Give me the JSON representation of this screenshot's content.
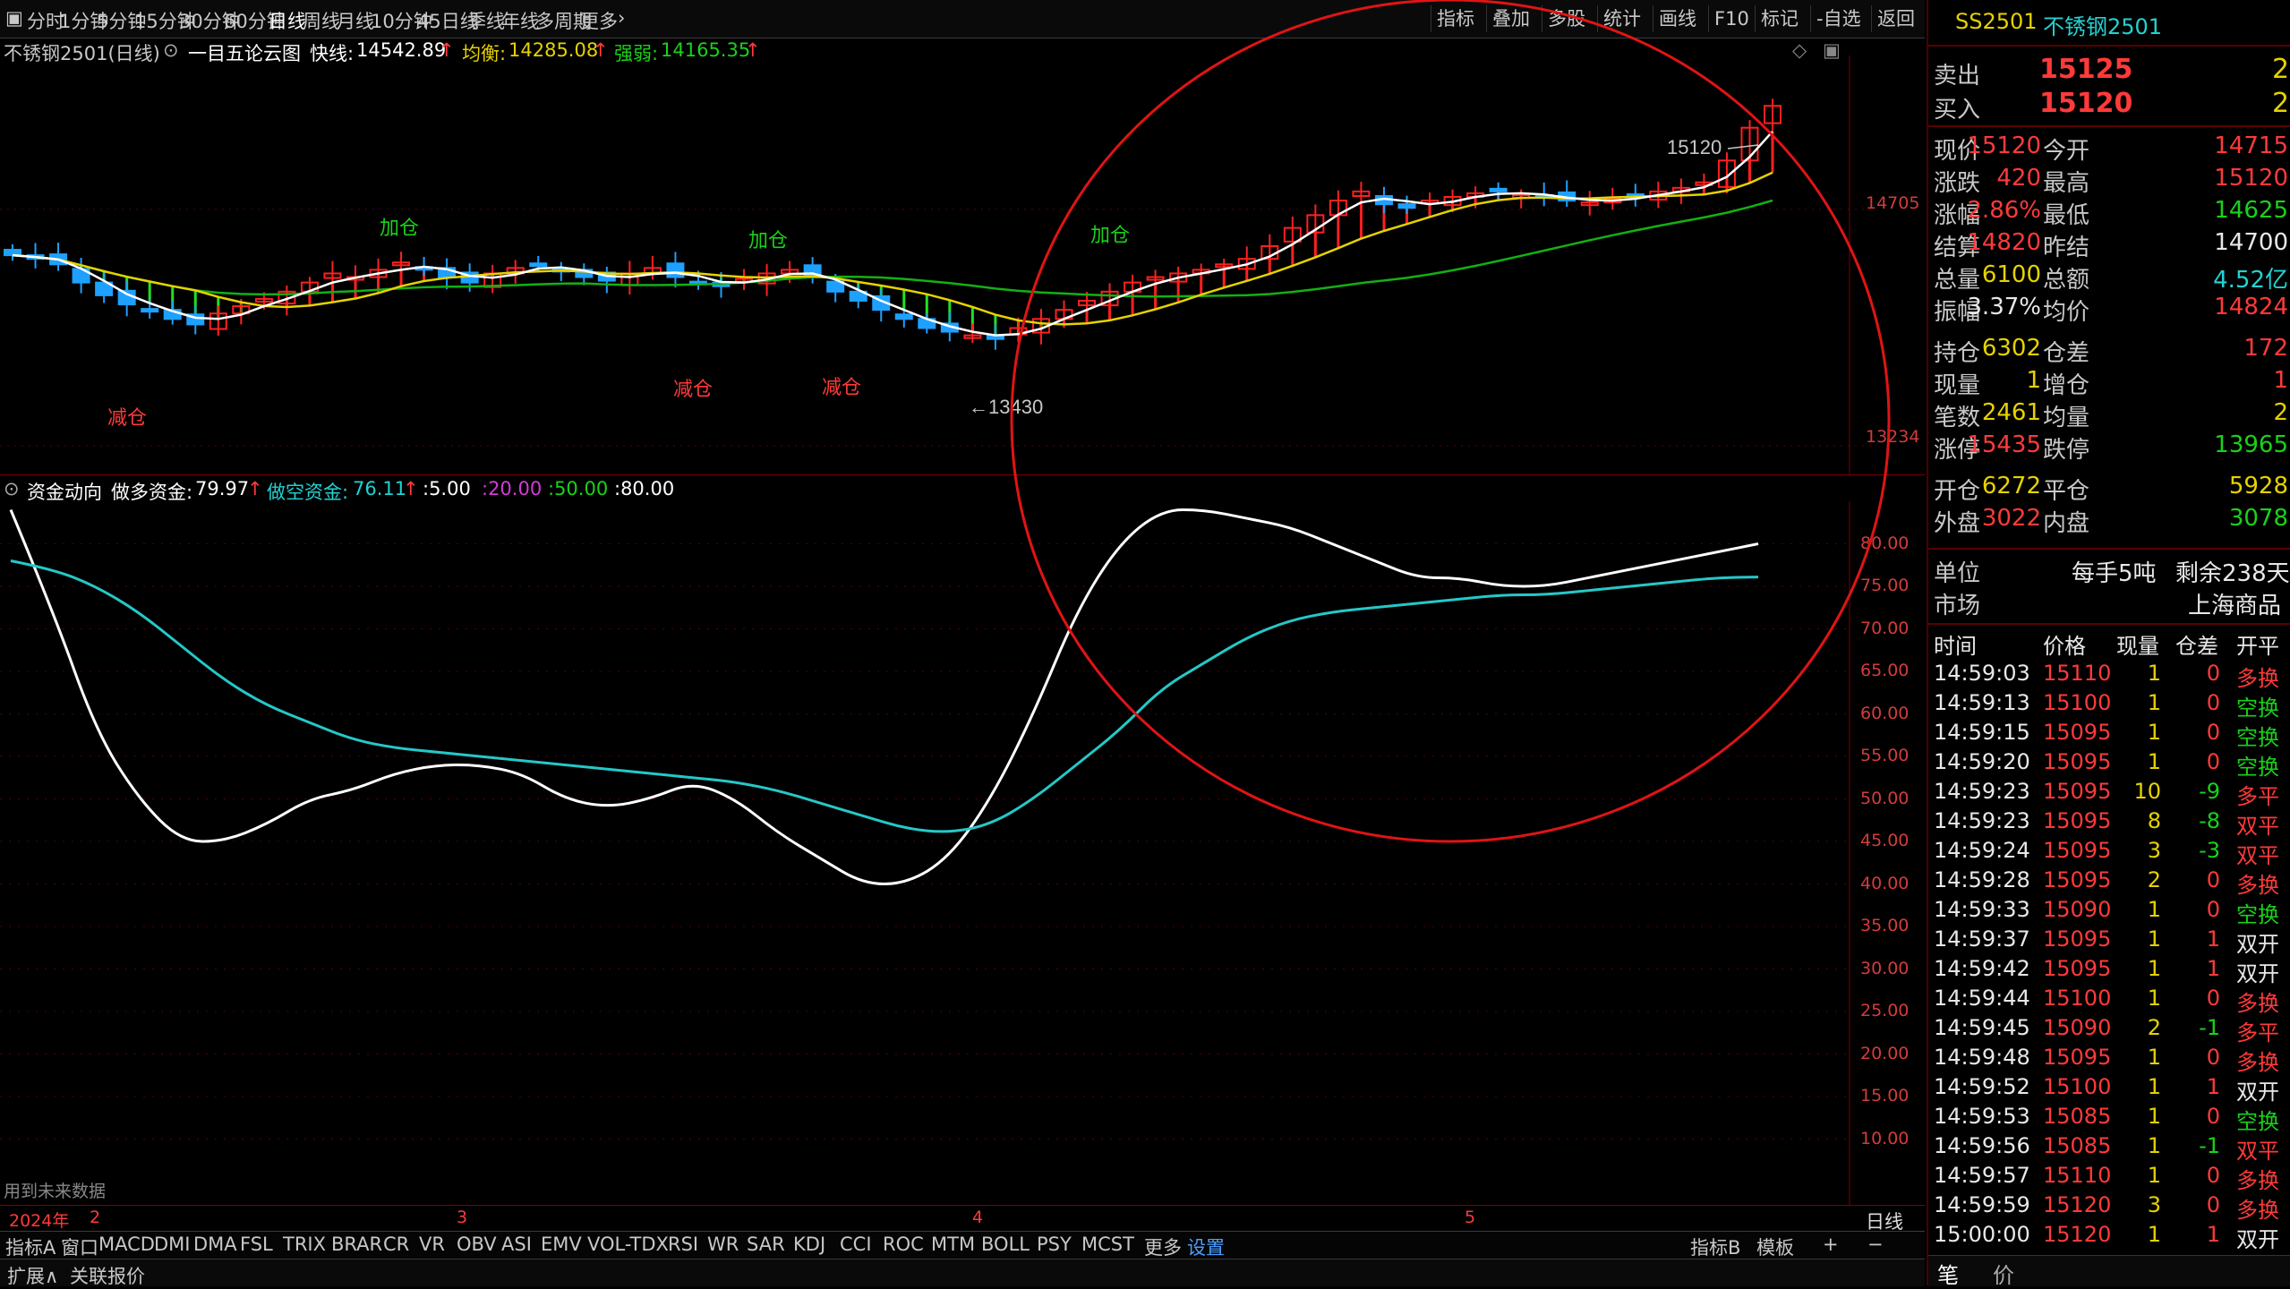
{
  "toolbar": {
    "periods": [
      "分时",
      "1分钟",
      "5分钟",
      "15分钟",
      "30分钟",
      "60分钟",
      "日线",
      "周线",
      "月线",
      "10分钟",
      "45日线",
      "季线",
      "年线",
      "多周期",
      "更多"
    ],
    "active_period": "日线",
    "right_buttons": [
      "指标",
      "叠加",
      "多股",
      "统计",
      "画线",
      "F10",
      "标记",
      "-自选",
      "返回"
    ]
  },
  "info": {
    "contract": "不锈钢2501(日线)",
    "indicator": "一目五论云图",
    "fast_label": "快线:",
    "fast_value": "14542.89",
    "balance_label": "均衡:",
    "balance_value": "14285.08",
    "strength_label": "强弱:",
    "strength_value": "14165.35"
  },
  "main_chart": {
    "axis_labels": [
      "14705",
      "13234"
    ],
    "annotations": {
      "add1": "加仓",
      "add2": "加仓",
      "add3": "加仓",
      "reduce1": "减仓",
      "reduce2": "减仓",
      "reduce3": "减仓",
      "high_label": "15120",
      "low_label": "13430"
    },
    "colors": {
      "up": "#ff2020",
      "down": "#1ea0ff",
      "fast": "#ffffff",
      "balance": "#e6d200",
      "strength": "#13b013"
    }
  },
  "indicator_panel": {
    "name": "资金动向",
    "bull_label": "做多资金:",
    "bull_value": "79.97",
    "bear_label": "做空资金:",
    "bear_value": "76.11",
    "levels": [
      ":5.00",
      ":20.00",
      ":50.00",
      ":80.00"
    ],
    "future_note": "用到未来数据",
    "y_ticks": [
      "80.00",
      "75.00",
      "70.00",
      "65.00",
      "60.00",
      "55.00",
      "50.00",
      "45.00",
      "40.00",
      "35.00",
      "30.00",
      "25.00",
      "20.00",
      "15.00",
      "10.00"
    ]
  },
  "chart_data": {
    "type": "line",
    "title": "资金动向",
    "ylim": [
      5,
      85
    ],
    "series": [
      {
        "name": "做多资金",
        "values": [
          84,
          72,
          58,
          50,
          45,
          45,
          47,
          50,
          51,
          53,
          54,
          54,
          53,
          50,
          49,
          50,
          52,
          50,
          46,
          43,
          40,
          40,
          43,
          50,
          60,
          72,
          80,
          84,
          84,
          83,
          82,
          80,
          78,
          76,
          76,
          75,
          75,
          76,
          77,
          78,
          79,
          80
        ]
      },
      {
        "name": "做空资金",
        "values": [
          78,
          77,
          75,
          72,
          68,
          64,
          61,
          59,
          57,
          56,
          55.5,
          55,
          54.5,
          54,
          53.5,
          53,
          52.5,
          52,
          51,
          49.5,
          48,
          46.5,
          46,
          47,
          50,
          54,
          58,
          63,
          66,
          69,
          71,
          72,
          72.5,
          73,
          73.5,
          74,
          74,
          74.5,
          75,
          75.5,
          76,
          76.1
        ]
      }
    ],
    "x_months": [
      "2024年",
      "2",
      "3",
      "4",
      "5"
    ]
  },
  "period_label": "日线",
  "tabs": [
    "指标A",
    "窗口",
    "MACD",
    "DMI",
    "DMA",
    "FSL",
    "TRIX",
    "BRAR",
    "CR",
    "VR",
    "OBV",
    "ASI",
    "EMV",
    "VOL-TDX",
    "RSI",
    "WR",
    "SAR",
    "KDJ",
    "CCI",
    "ROC",
    "MTM",
    "BOLL",
    "PSY",
    "MCST",
    "更多",
    "设置"
  ],
  "tabs_right": [
    "指标B",
    "模板",
    "+",
    "−"
  ],
  "status": [
    "扩展∧",
    "关联报价"
  ],
  "quote": {
    "code": "SS2501",
    "name": "不锈钢2501",
    "sell_label": "卖出",
    "sell_price": "15125",
    "sell_qty": "2",
    "buy_label": "买入",
    "buy_price": "15120",
    "buy_qty": "2",
    "rows": [
      [
        "现价",
        "15120",
        "今开",
        "14715"
      ],
      [
        "涨跌",
        "420",
        "最高",
        "15120"
      ],
      [
        "涨幅",
        "2.86%",
        "最低",
        "14625"
      ],
      [
        "结算",
        "14820",
        "昨结",
        "14700"
      ],
      [
        "总量",
        "6100",
        "总额",
        "4.52亿"
      ],
      [
        "振幅",
        "3.37%",
        "均价",
        "14824"
      ],
      [
        "持仓",
        "6302",
        "仓差",
        "172"
      ],
      [
        "现量",
        "1",
        "增仓",
        "1"
      ],
      [
        "笔数",
        "2461",
        "均量",
        "2"
      ],
      [
        "涨停",
        "15435",
        "跌停",
        "13965"
      ],
      [
        "开仓",
        "6272",
        "平仓",
        "5928"
      ],
      [
        "外盘",
        "3022",
        "内盘",
        "3078"
      ]
    ],
    "unit_label": "单位",
    "unit_value": "每手5吨",
    "remain": "剩余238天",
    "market_label": "市场",
    "market_value": "上海商品"
  },
  "ticks": {
    "headers": [
      "时间",
      "价格",
      "现量",
      "仓差",
      "开平"
    ],
    "rows": [
      [
        "14:59:03",
        "15110",
        "1",
        "0",
        "多换"
      ],
      [
        "14:59:13",
        "15100",
        "1",
        "0",
        "空换"
      ],
      [
        "14:59:15",
        "15095",
        "1",
        "0",
        "空换"
      ],
      [
        "14:59:20",
        "15095",
        "1",
        "0",
        "空换"
      ],
      [
        "14:59:23",
        "15095",
        "10",
        "-9",
        "多平"
      ],
      [
        "14:59:23",
        "15095",
        "8",
        "-8",
        "双平"
      ],
      [
        "14:59:24",
        "15095",
        "3",
        "-3",
        "双平"
      ],
      [
        "14:59:28",
        "15095",
        "2",
        "0",
        "多换"
      ],
      [
        "14:59:33",
        "15090",
        "1",
        "0",
        "空换"
      ],
      [
        "14:59:37",
        "15095",
        "1",
        "1",
        "双开"
      ],
      [
        "14:59:42",
        "15095",
        "1",
        "1",
        "双开"
      ],
      [
        "14:59:44",
        "15100",
        "1",
        "0",
        "多换"
      ],
      [
        "14:59:45",
        "15090",
        "2",
        "-1",
        "多平"
      ],
      [
        "14:59:48",
        "15095",
        "1",
        "0",
        "多换"
      ],
      [
        "14:59:52",
        "15100",
        "1",
        "1",
        "双开"
      ],
      [
        "14:59:53",
        "15085",
        "1",
        "0",
        "空换"
      ],
      [
        "14:59:56",
        "15085",
        "1",
        "-1",
        "双平"
      ],
      [
        "14:59:57",
        "15110",
        "1",
        "0",
        "多换"
      ],
      [
        "14:59:59",
        "15120",
        "3",
        "0",
        "多换"
      ],
      [
        "15:00:00",
        "15120",
        "1",
        "1",
        "双开"
      ]
    ],
    "bottom_tabs": [
      "笔",
      "价"
    ]
  }
}
